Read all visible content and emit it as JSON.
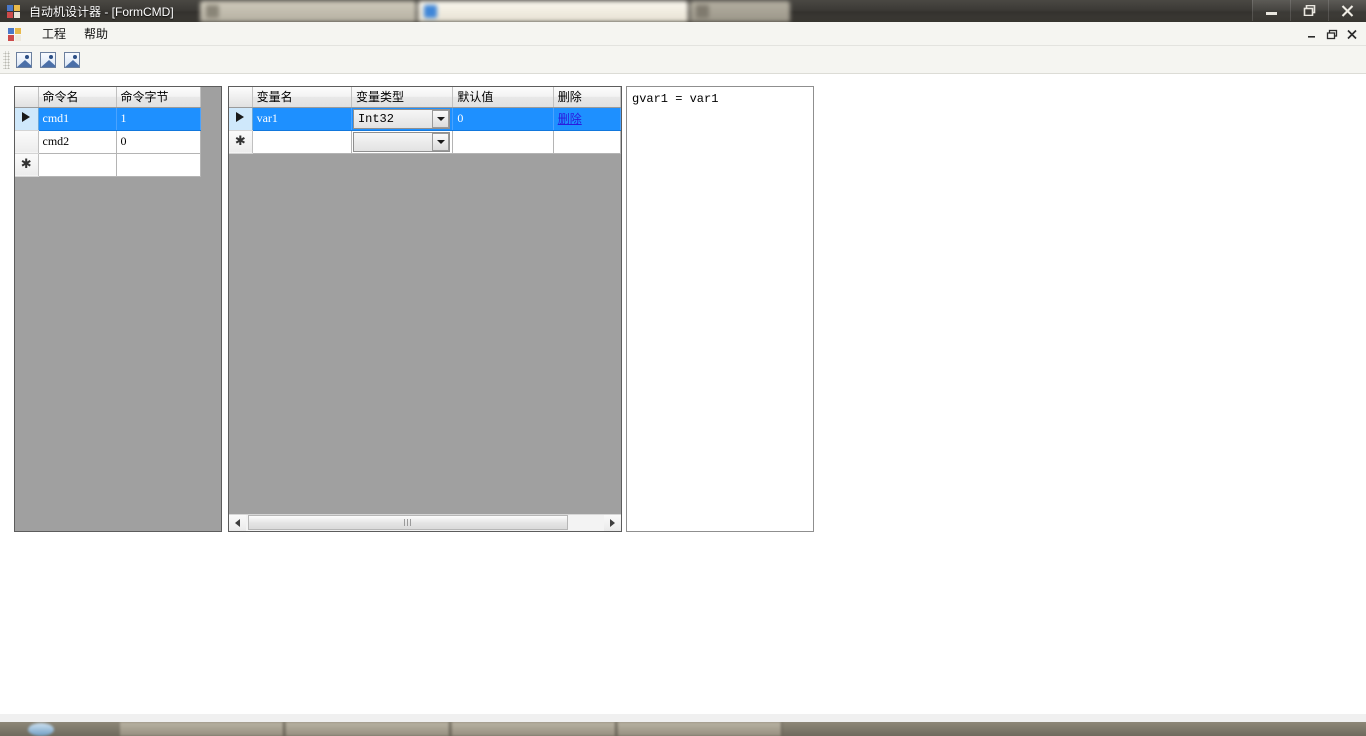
{
  "window": {
    "title": "自动机设计器 - [FormCMD]",
    "app_icon": "app-squares-icon",
    "buttons": {
      "minimize": "minimize-icon",
      "restore": "restore-icon",
      "close": "close-icon"
    }
  },
  "background_tabs": [
    {
      "label": ""
    },
    {
      "label": ""
    },
    {
      "label": ""
    }
  ],
  "menubar": {
    "items": [
      {
        "label": "工程"
      },
      {
        "label": "帮助"
      }
    ],
    "mdi_buttons": {
      "minimize": "minimize-icon",
      "restore": "restore-icon",
      "close": "close-icon"
    }
  },
  "toolbar": {
    "buttons": [
      {
        "icon": "picture-icon",
        "label": ""
      },
      {
        "icon": "picture-icon",
        "label": ""
      },
      {
        "icon": "picture-icon",
        "label": ""
      }
    ]
  },
  "commands_grid": {
    "columns": [
      "命令名",
      "命令字节"
    ],
    "rows": [
      {
        "marker": "arrow",
        "selected": true,
        "cells": [
          "cmd1",
          "1"
        ]
      },
      {
        "marker": "",
        "selected": false,
        "cells": [
          "cmd2",
          "0"
        ]
      },
      {
        "marker": "star",
        "selected": false,
        "cells": [
          "",
          ""
        ]
      }
    ]
  },
  "variables_grid": {
    "columns": [
      "变量名",
      "变量类型",
      "默认值",
      "删除"
    ],
    "rows": [
      {
        "marker": "arrow",
        "selected": true,
        "name": "var1",
        "type": "Int32",
        "default": "0",
        "delete_label": "删除"
      },
      {
        "marker": "star",
        "selected": false,
        "name": "",
        "type": "",
        "default": "",
        "delete_label": ""
      }
    ],
    "scrollbar": {
      "left_arrow": "chevron-left-icon",
      "right_arrow": "chevron-right-icon"
    }
  },
  "code_panel": {
    "text": "gvar1 = var1"
  },
  "colors": {
    "selection": "#1e90ff",
    "grid_background": "#a0a0a0",
    "link": "#0000ee",
    "row_header_selected": "#cfe8fb"
  },
  "taskbar": {
    "clock": ""
  }
}
